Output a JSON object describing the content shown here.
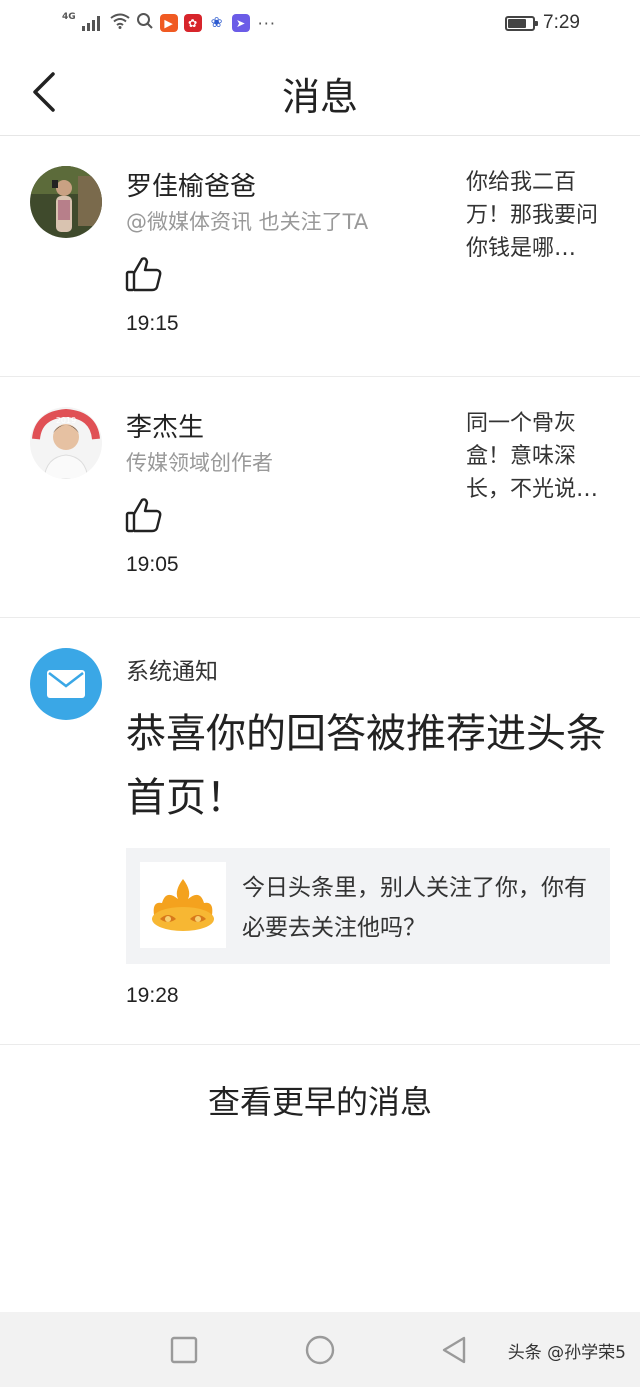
{
  "status_bar": {
    "network": "4G",
    "time": "7:29",
    "battery_level": 0.75,
    "icons": [
      "signal-icon",
      "wifi-icon",
      "search-icon",
      "app-icon-orange",
      "app-icon-huawei",
      "app-icon-baidu",
      "app-icon-purple",
      "more-dots-icon",
      "battery-icon"
    ]
  },
  "header": {
    "title": "消息",
    "back_icon": "chevron-left-icon"
  },
  "messages": [
    {
      "name": "罗佳榆爸爸",
      "subtitle": "@微媒体资讯 也关注了TA",
      "time": "19:15",
      "preview": "你给我二百万！那我要问你钱是哪…",
      "icon": "thumbs-up-icon"
    },
    {
      "name": "李杰生",
      "subtitle": "传媒领域创作者",
      "time": "19:05",
      "preview": "同一个骨灰盒！意味深长，不光说…",
      "icon": "thumbs-up-icon"
    }
  ],
  "system": {
    "label": "系统通知",
    "headline": "恭喜你的回答被推荐进头条首页！",
    "card_text": "今日头条里，别人关注了你，你有必要去关注他吗？",
    "time": "19:28",
    "icon": "mail-icon",
    "card_icon": "golden-cloud-icon"
  },
  "view_earlier": "查看更早的消息",
  "nav": {
    "watermark": "头条 @孙学荣5",
    "icons": [
      "square-recent-icon",
      "circle-home-icon",
      "triangle-back-icon"
    ]
  },
  "colors": {
    "accent_blue": "#3aa7e6",
    "divider": "#ebebeb",
    "card_bg": "#f2f3f5",
    "muted_text": "#999999"
  }
}
